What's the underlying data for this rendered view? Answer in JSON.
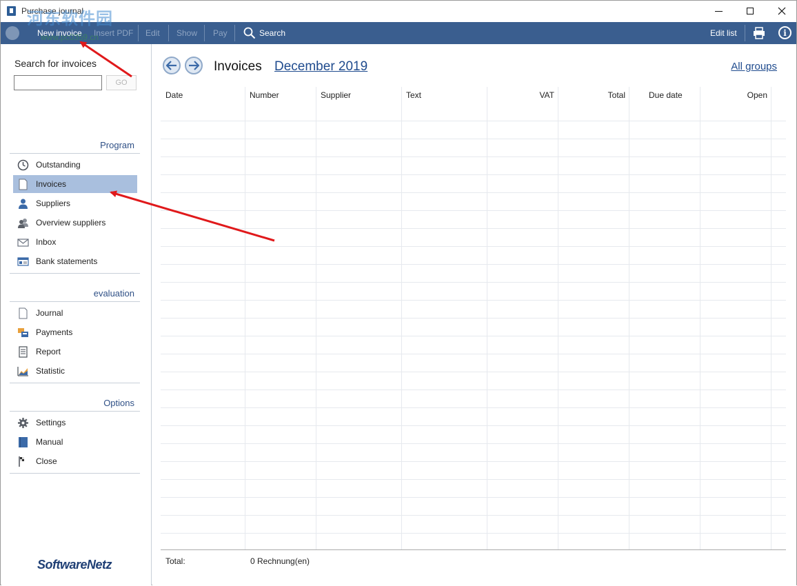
{
  "window": {
    "title": "Purchase journal",
    "watermark": "河东软件园",
    "watermark_url": "www.pc0359.cn"
  },
  "toolbar": {
    "new_invoice": "New invoice",
    "insert_pdf": "Insert PDF",
    "edit": "Edit",
    "show": "Show",
    "pay": "Pay",
    "search": "Search",
    "edit_list": "Edit list"
  },
  "sidebar": {
    "search_label": "Search for invoices",
    "search_value": "",
    "go_label": "GO",
    "sections": {
      "program": "Program",
      "evaluation": "evaluation",
      "options": "Options"
    },
    "program_items": [
      {
        "label": "Outstanding",
        "icon": "clock-icon"
      },
      {
        "label": "Invoices",
        "icon": "document-icon",
        "active": true
      },
      {
        "label": "Suppliers",
        "icon": "person-icon"
      },
      {
        "label": "Overview suppliers",
        "icon": "people-icon"
      },
      {
        "label": "Inbox",
        "icon": "envelope-icon"
      },
      {
        "label": "Bank statements",
        "icon": "bank-statement-icon"
      }
    ],
    "evaluation_items": [
      {
        "label": "Journal",
        "icon": "page-icon"
      },
      {
        "label": "Payments",
        "icon": "payments-icon"
      },
      {
        "label": "Report",
        "icon": "report-icon"
      },
      {
        "label": "Statistic",
        "icon": "chart-icon"
      }
    ],
    "options_items": [
      {
        "label": "Settings",
        "icon": "gear-icon"
      },
      {
        "label": "Manual",
        "icon": "book-icon"
      },
      {
        "label": "Close",
        "icon": "flag-icon"
      }
    ],
    "brand": "SoftwareNetz"
  },
  "main": {
    "title": "Invoices",
    "period": "December 2019",
    "groups_link": "All groups",
    "columns": [
      "Date",
      "Number",
      "Supplier",
      "Text",
      "VAT",
      "Total",
      "Due date",
      "Open"
    ],
    "footer_total_label": "Total:",
    "footer_count": "0 Rechnung(en)"
  },
  "colors": {
    "toolbar_bg": "#3a5e8f",
    "active_item_bg": "#a9bfde",
    "link": "#1f4b8e",
    "section_header": "#2f5086",
    "annotation_arrow": "#e0191b"
  }
}
